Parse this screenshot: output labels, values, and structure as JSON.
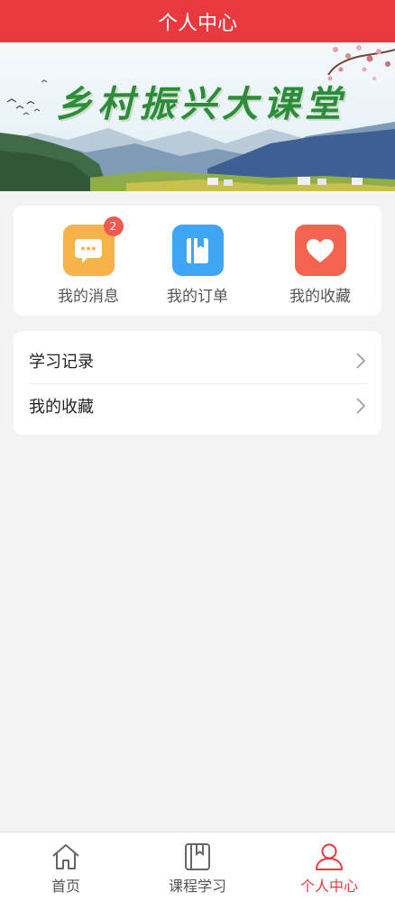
{
  "header": {
    "title": "个人中心"
  },
  "banner": {
    "title": "乡村振兴大课堂"
  },
  "quick_actions": [
    {
      "label": "我的消息",
      "icon": "message-icon",
      "color": "#f8b24a",
      "badge": "2"
    },
    {
      "label": "我的订单",
      "icon": "book-icon",
      "color": "#3fa6f6"
    },
    {
      "label": "我的收藏",
      "icon": "heart-icon",
      "color": "#f3634e"
    }
  ],
  "menu": [
    {
      "label": "学习记录"
    },
    {
      "label": "我的收藏"
    }
  ],
  "tabbar": [
    {
      "label": "首页",
      "icon": "home-icon",
      "active": false
    },
    {
      "label": "课程学习",
      "icon": "course-icon",
      "active": false
    },
    {
      "label": "个人中心",
      "icon": "user-icon",
      "active": true
    }
  ],
  "colors": {
    "primary": "#e8393f",
    "background": "#f3f3f3"
  }
}
